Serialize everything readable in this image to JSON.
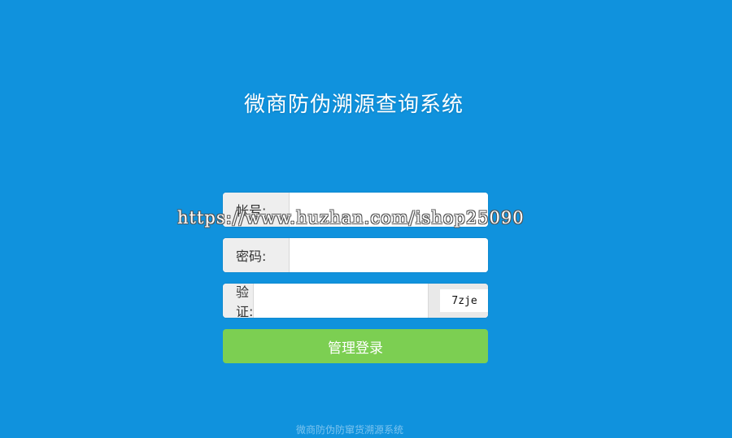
{
  "page": {
    "title": "微商防伪溯源查询系统",
    "footer": "微商防伪防窜货溯源系统",
    "watermark": "https://www.huzhan.com/ishop25090"
  },
  "form": {
    "account_label": "帐号:",
    "account_value": "",
    "password_label": "密码:",
    "password_value": "",
    "captcha_label": "验证:",
    "captcha_value": "",
    "captcha_text": "7zje",
    "submit_label": "管理登录"
  },
  "colors": {
    "background": "#1092dd",
    "button": "#7ccf52",
    "label_bg": "#eeeeee"
  }
}
